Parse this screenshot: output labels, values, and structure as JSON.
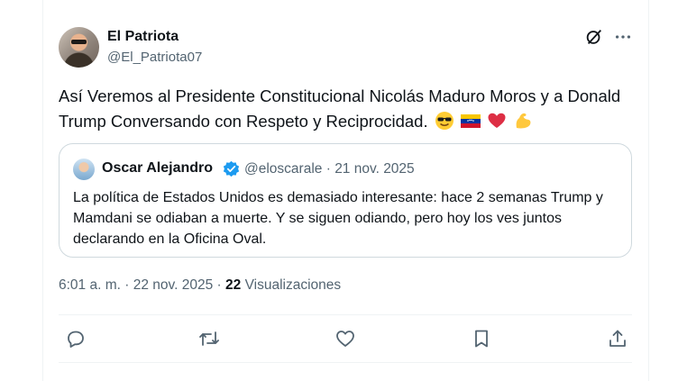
{
  "author": {
    "name": "El Patriota",
    "handle": "@El_Patriota07"
  },
  "post": {
    "text": "Así Veremos al Presidente Constitucional Nicolás Maduro Moros y a Donald Trump Conversando con Respeto y Reciprocidad.",
    "emojis": [
      "smiling-face-with-sunglasses",
      "venezuela-flag",
      "red-heart",
      "flexed-biceps"
    ],
    "time": "6:01 a. m.",
    "separator": "·",
    "date": "22 nov. 2025",
    "views_count": "22",
    "views_label": "Visualizaciones"
  },
  "quoted": {
    "name": "Oscar Alejandro",
    "handle": "@eloscarale",
    "separator": "·",
    "date": "21 nov. 2025",
    "text": "La política de Estados Unidos es demasiado interesante: hace 2 semanas Trump y Mamdani se odiaban a muerte. Y se siguen odiando, pero hoy los ves juntos declarando en la Oficina Oval."
  },
  "actions": [
    "reply-icon",
    "repost-icon",
    "like-icon",
    "bookmark-icon",
    "share-icon"
  ],
  "colors": {
    "text": "#0f1419",
    "secondary": "#536471",
    "border": "#cfd9de",
    "verified": "#1d9bf0"
  }
}
